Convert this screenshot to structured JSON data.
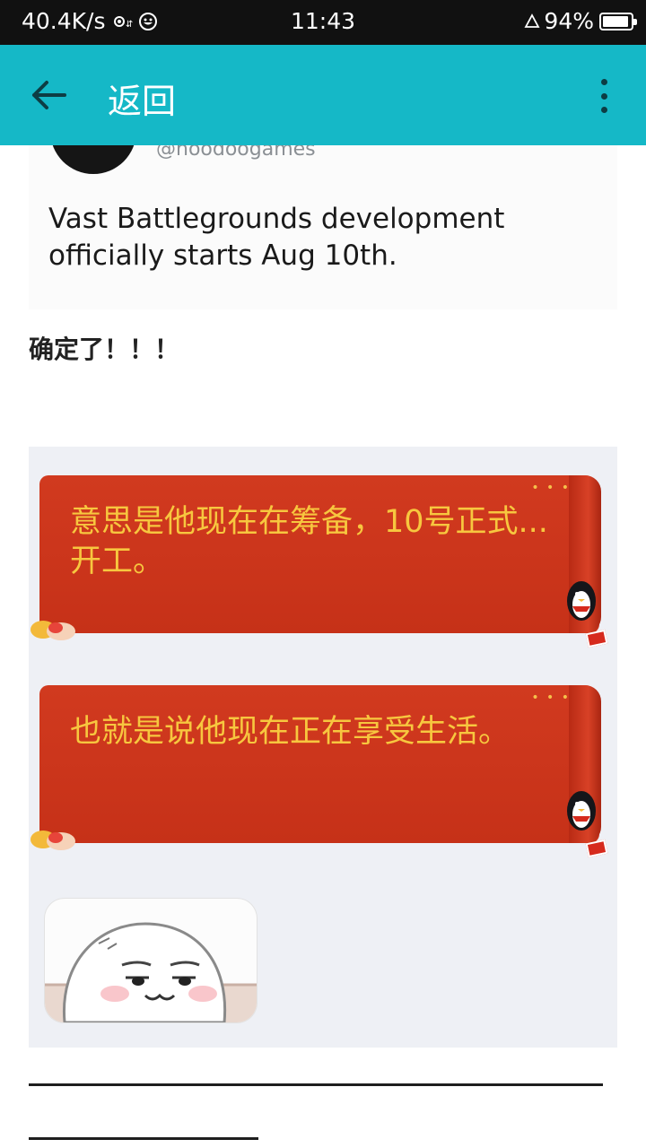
{
  "status_bar": {
    "net_speed": "40.4K/s",
    "time": "11:43",
    "battery_percent": "94%",
    "battery_level": 0.94,
    "icons": [
      "location-icon",
      "emoji-icon",
      "alarm-triangle-icon",
      "battery-icon"
    ]
  },
  "app_bar": {
    "back_label": "返回",
    "color": "#15b8c7"
  },
  "tweet": {
    "handle": "@hoodoogames",
    "text": "Vast Battlegrounds development officially starts Aug 10th."
  },
  "caption": "确定了！！！",
  "chat": {
    "bubbles": [
      {
        "text": "意思是他现在在筹备，10号正式...开工。"
      },
      {
        "text": "也就是说他现在正在享受生活。"
      }
    ],
    "bubble_color": "#c63118",
    "text_color": "#f7c73f"
  }
}
